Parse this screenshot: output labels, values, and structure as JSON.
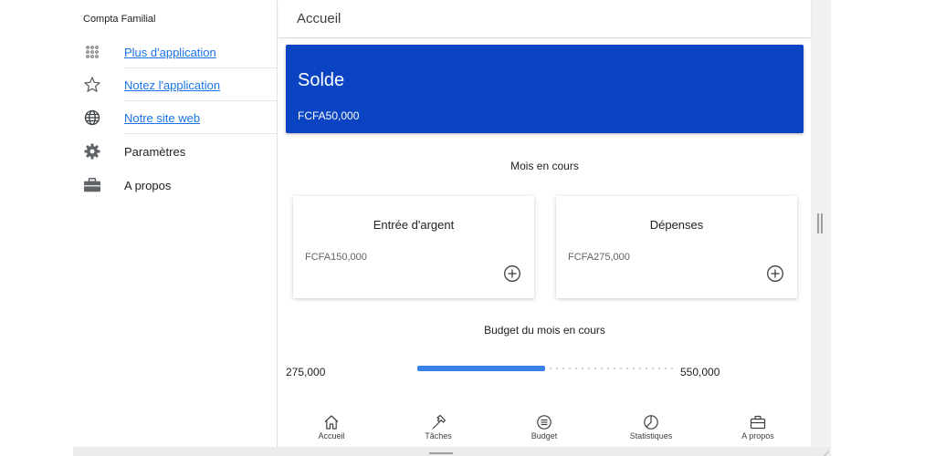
{
  "sidebar": {
    "app_name": "Compta Familial",
    "items": [
      {
        "label": "Plus d'application",
        "icon": "apps-grid-icon"
      },
      {
        "label": "Notez l'application",
        "icon": "star-icon"
      },
      {
        "label": "Notre site web",
        "icon": "globe-icon"
      },
      {
        "label": "Paramètres",
        "icon": "gear-icon"
      },
      {
        "label": "A propos",
        "icon": "briefcase-icon"
      }
    ]
  },
  "header": {
    "title": "Accueil"
  },
  "balance": {
    "title": "Solde",
    "value": "FCFA50,000"
  },
  "current_month": {
    "title": "Mois en cours",
    "income": {
      "title": "Entrée d'argent",
      "value": "FCFA150,000"
    },
    "expenses": {
      "title": "Dépenses",
      "value": "FCFA275,000"
    }
  },
  "budget": {
    "title": "Budget du mois en cours",
    "spent": "275,000",
    "total": "550,000",
    "progress": 0.5
  },
  "bottom_nav": [
    {
      "label": "Accueil",
      "icon": "home-icon"
    },
    {
      "label": "Tâches",
      "icon": "hammer-icon"
    },
    {
      "label": "Budget",
      "icon": "list-circle-icon"
    },
    {
      "label": "Statistiques",
      "icon": "pie-chart-icon"
    },
    {
      "label": "A propos",
      "icon": "briefcase-icon"
    }
  ],
  "colors": {
    "accent": "#0a44c2",
    "progress": "#3b82e8",
    "link": "#1a73e8"
  }
}
